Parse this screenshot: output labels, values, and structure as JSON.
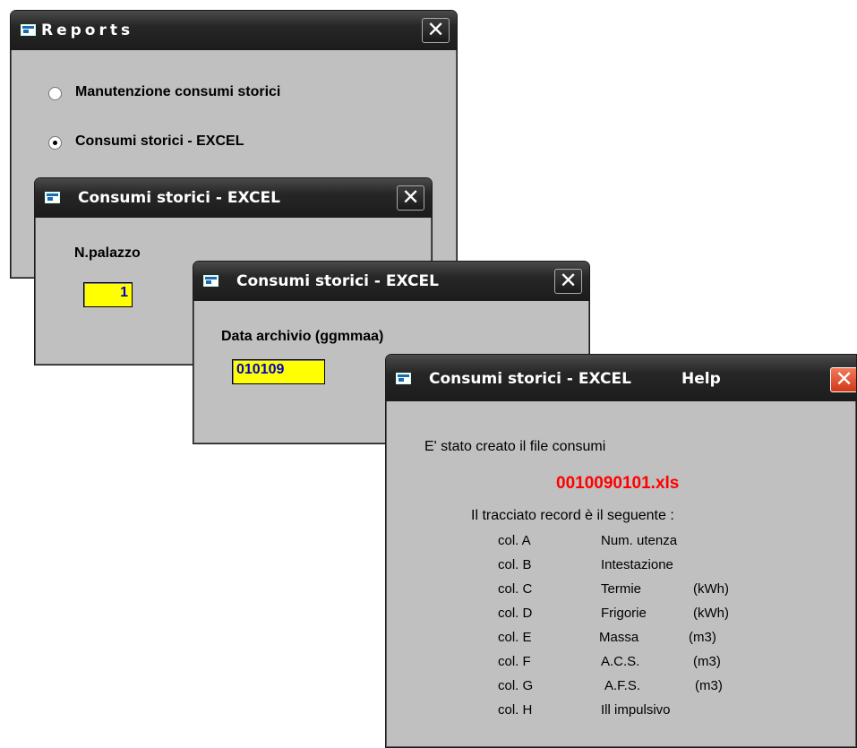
{
  "reports_window": {
    "title": "Reports",
    "options": [
      {
        "label": "Manutenzione consumi storici",
        "checked": false
      },
      {
        "label": "Consumi storici - EXCEL",
        "checked": true
      }
    ]
  },
  "palazzo_window": {
    "title": "Consumi storici - EXCEL",
    "field_label": "N.palazzo",
    "field_value": "1"
  },
  "data_window": {
    "title": "Consumi storici - EXCEL",
    "field_label": "Data archivio (ggmmaa)",
    "field_value": "010109"
  },
  "help_window": {
    "title": "Consumi storici - EXCEL",
    "title_help": "Help",
    "message": "E' stato creato il file consumi",
    "filename": "0010090101.xls",
    "filename_color": "#ff0000",
    "record_intro": "Il tracciato record è il seguente  :",
    "columns": [
      {
        "col": "col. A",
        "desc": "Num. utenza",
        "unit": ""
      },
      {
        "col": "col. B",
        "desc": "Intestazione",
        "unit": ""
      },
      {
        "col": "col. C",
        "desc": "Termie",
        "unit": "(kWh)"
      },
      {
        "col": "col. D",
        "desc": "Frigorie",
        "unit": "(kWh)"
      },
      {
        "col": "col. E",
        "desc": "Massa",
        "unit": "(m3)"
      },
      {
        "col": "col. F",
        "desc": "A.C.S.",
        "unit": "(m3)"
      },
      {
        "col": "col. G",
        "desc": "A.F.S.",
        "unit": "(m3)"
      },
      {
        "col": "col. H",
        "desc": "Ill impulsivo",
        "unit": ""
      }
    ]
  },
  "icons": {
    "window": "window-app-icon",
    "close": "close-icon"
  }
}
